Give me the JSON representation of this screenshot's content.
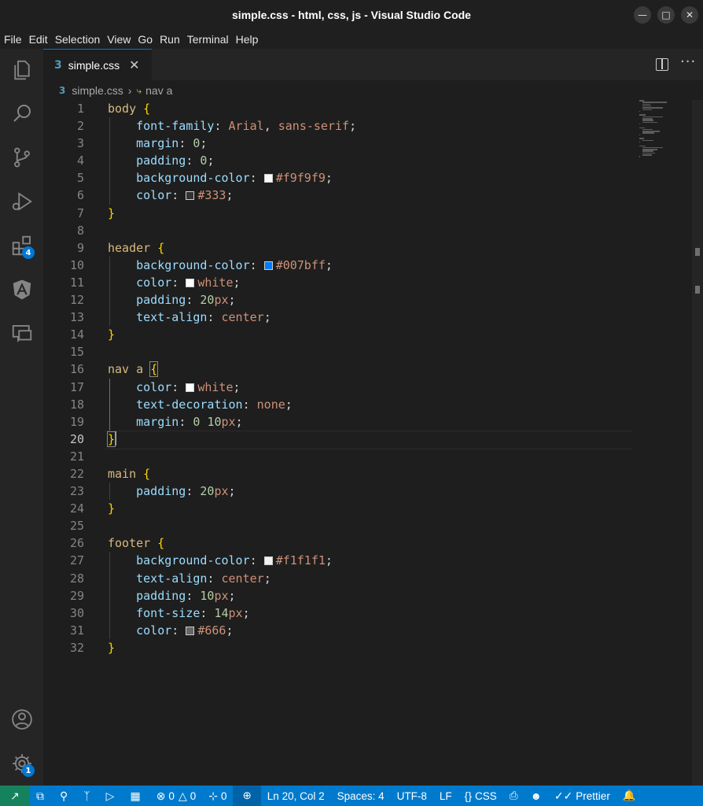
{
  "window": {
    "title": "simple.css - html, css, js - Visual Studio Code"
  },
  "menu": [
    "File",
    "Edit",
    "Selection",
    "View",
    "Go",
    "Run",
    "Terminal",
    "Help"
  ],
  "activity_bar": {
    "items": [
      {
        "name": "explorer-icon"
      },
      {
        "name": "search-icon"
      },
      {
        "name": "source-control-icon"
      },
      {
        "name": "run-debug-icon"
      },
      {
        "name": "extensions-icon",
        "badge": "4"
      },
      {
        "name": "angular-icon"
      },
      {
        "name": "remote-explorer-icon"
      }
    ],
    "bottom": [
      {
        "name": "account-icon"
      },
      {
        "name": "settings-gear-icon",
        "badge": "1"
      }
    ]
  },
  "tab": {
    "label": "simple.css",
    "icon": "css-file-icon"
  },
  "breadcrumb": {
    "file": "simple.css",
    "symbol": "nav a"
  },
  "editor": {
    "active_line": 20,
    "lines": [
      "body {",
      "    font-family: Arial, sans-serif;",
      "    margin: 0;",
      "    padding: 0;",
      "    background-color: #f9f9f9;",
      "    color: #333;",
      "}",
      "",
      "header {",
      "    background-color: #007bff;",
      "    color: white;",
      "    padding: 20px;",
      "    text-align: center;",
      "}",
      "",
      "nav a {",
      "    color: white;",
      "    text-decoration: none;",
      "    margin: 0 10px;",
      "}",
      "",
      "main {",
      "    padding: 20px;",
      "}",
      "",
      "footer {",
      "    background-color: #f1f1f1;",
      "    text-align: center;",
      "    padding: 10px;",
      "    font-size: 14px;",
      "    color: #666;",
      "}"
    ]
  },
  "status_bar": {
    "errors": "0",
    "warnings": "0",
    "ports": "0",
    "cursor": "Ln 20, Col 2",
    "spaces": "Spaces: 4",
    "encoding": "UTF-8",
    "eol": "LF",
    "language": "CSS",
    "formatter": "Prettier"
  },
  "colors": {
    "accent": "#007acc",
    "remote": "#16825d",
    "selector": "#d7ba7d",
    "property": "#9cdcfe",
    "value": "#ce9178",
    "number": "#b5cea8",
    "brace": "#ffd700"
  }
}
